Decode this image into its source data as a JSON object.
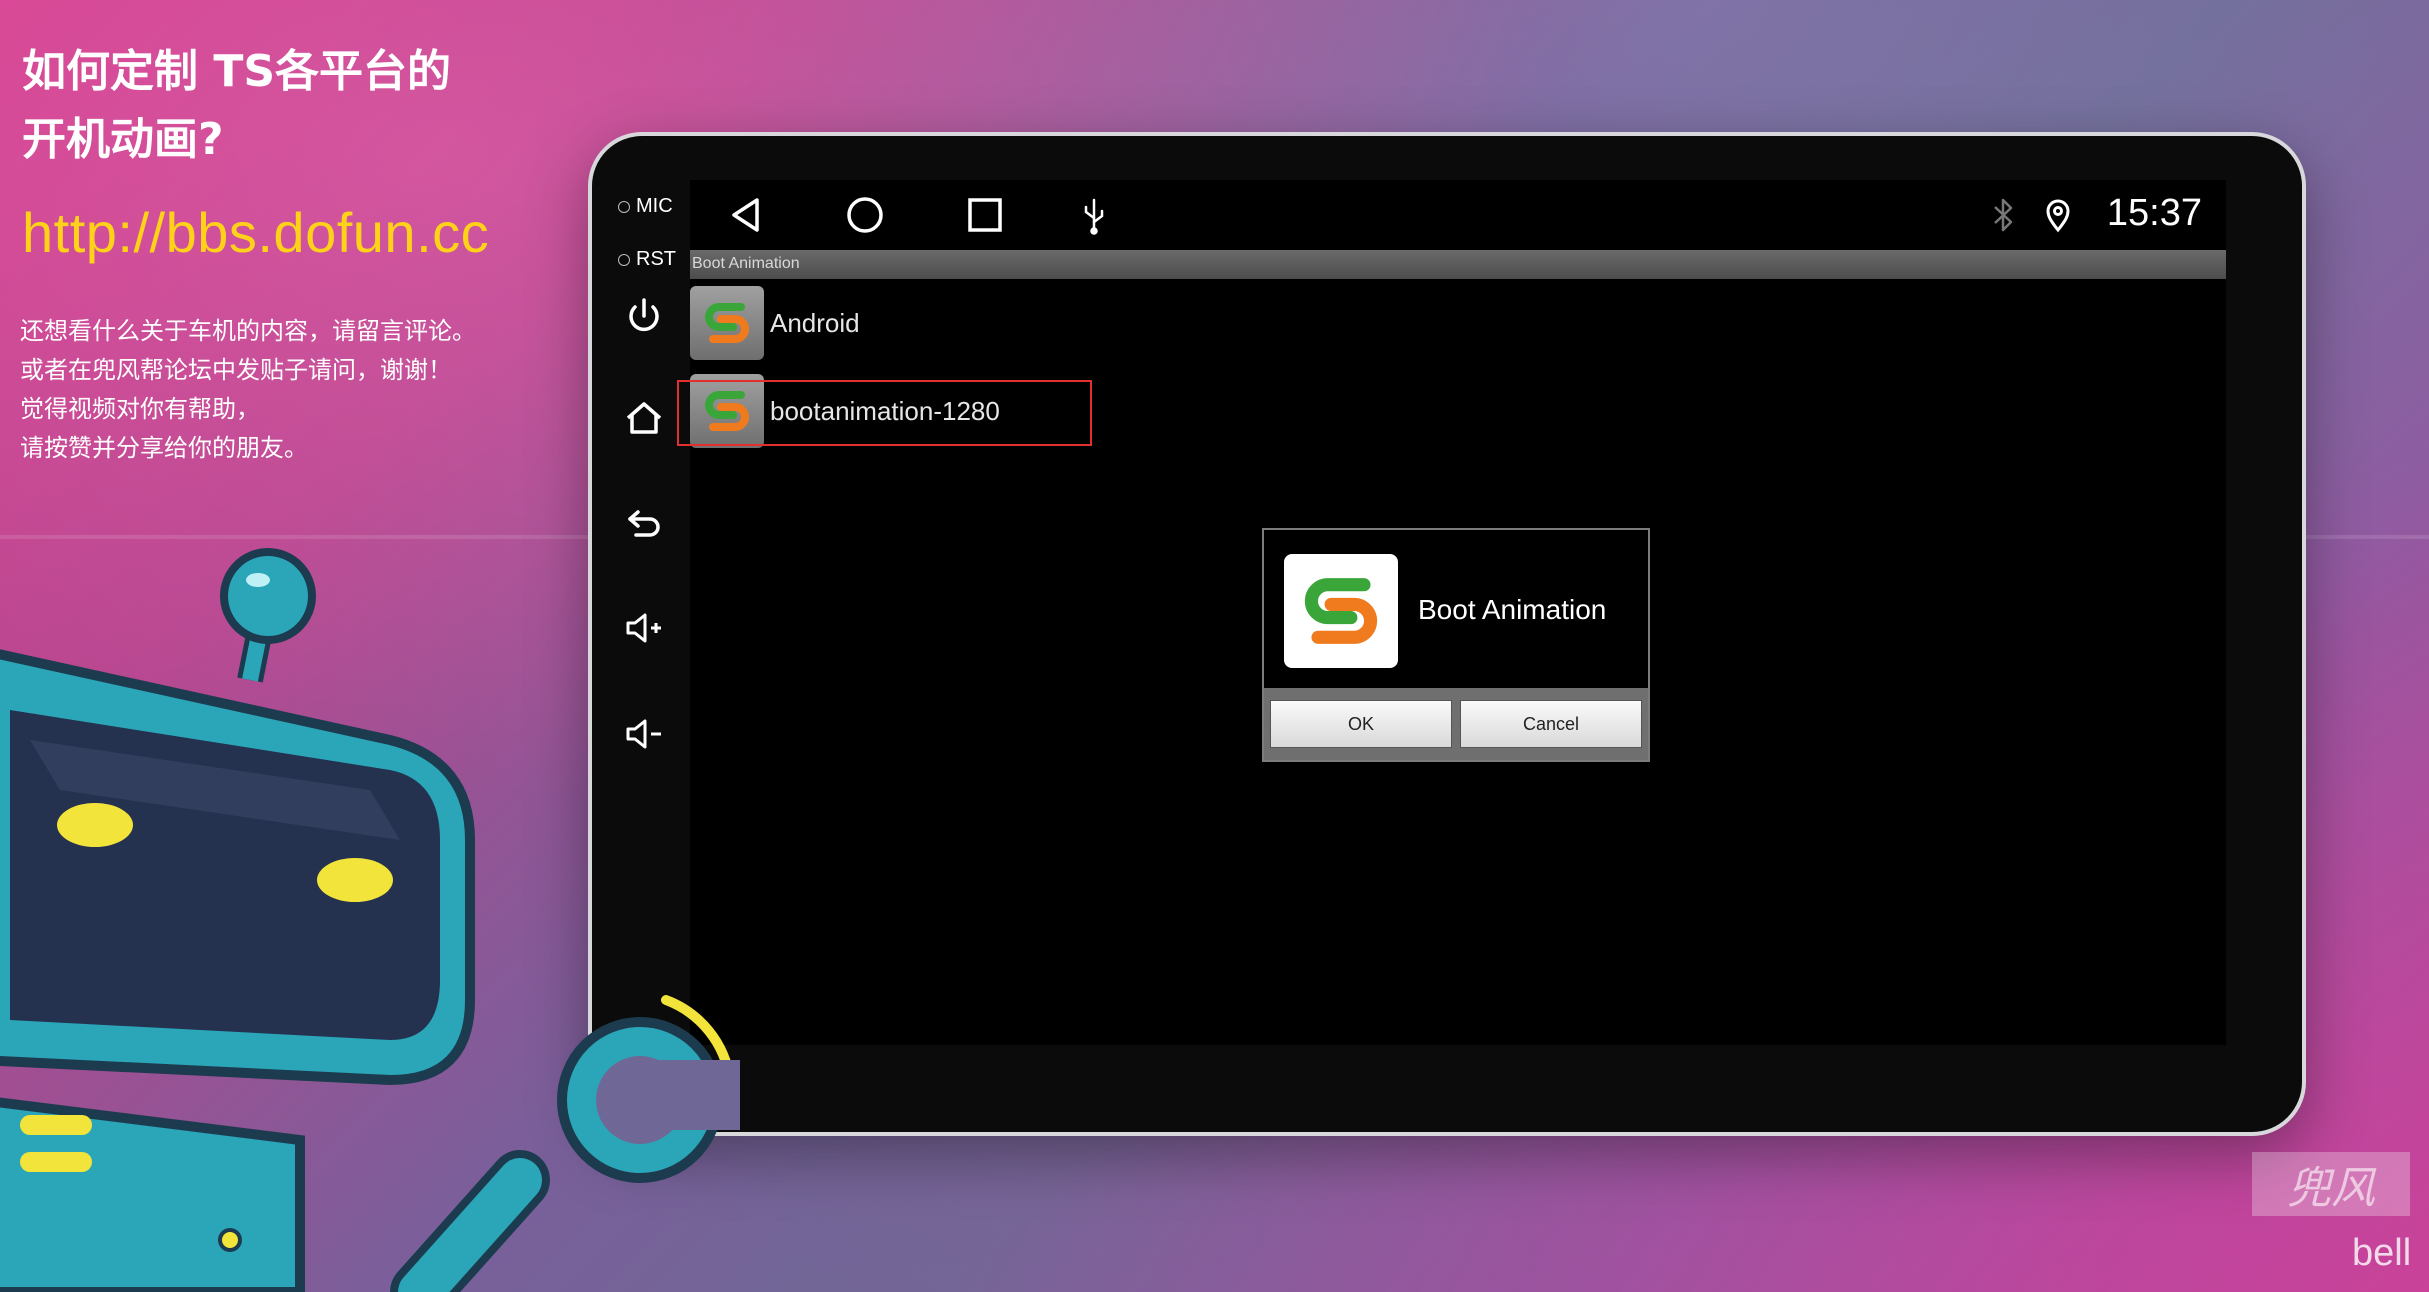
{
  "left_panel": {
    "title_line1": "如何定制 TS各平台的",
    "title_line2": "开机动画?",
    "url": "http://bbs.dofun.cc",
    "desc": [
      "还想看什么关于车机的内容，请留言评论。",
      "或者在兜风帮论坛中发贴子请问，谢谢！",
      "觉得视频对你有帮助，",
      "请按赞并分享给你的朋友。"
    ]
  },
  "device": {
    "side_labels": {
      "mic": "MIC",
      "rst": "RST"
    },
    "side_icons": [
      "power-icon",
      "home-icon",
      "back-icon",
      "volume-up-icon",
      "volume-down-icon"
    ]
  },
  "status_bar": {
    "nav_icons": [
      "back-triangle-icon",
      "home-circle-icon",
      "recents-square-icon",
      "usb-icon"
    ],
    "status_icons": [
      "bluetooth-icon",
      "location-pin-icon"
    ],
    "time": "15:37"
  },
  "app": {
    "title": "Boot Animation",
    "items": [
      {
        "label": "Android",
        "selected": false
      },
      {
        "label": "bootanimation-1280",
        "selected": true
      }
    ]
  },
  "dialog": {
    "title": "Boot Animation",
    "ok": "OK",
    "cancel": "Cancel"
  },
  "watermark": {
    "logo_text": "兜风",
    "author": "bell"
  },
  "colors": {
    "highlight": "#e03030",
    "url_yellow": "#ffd21a",
    "logo_green": "#3aa63a",
    "logo_orange": "#f07b1e"
  }
}
